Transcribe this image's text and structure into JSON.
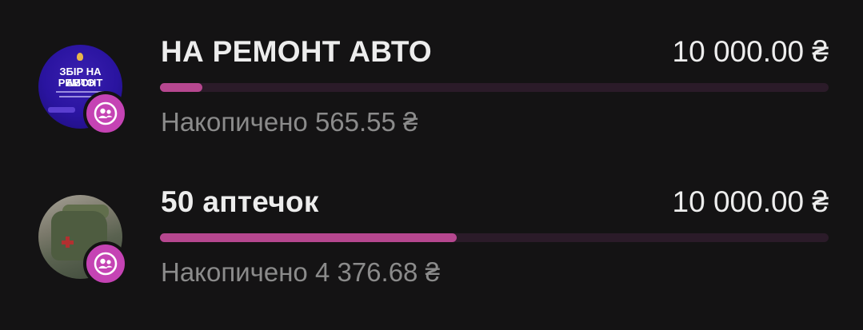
{
  "jars": [
    {
      "avatar_text_line1": "ЗБІР НА РЕМОНТ",
      "avatar_text_line2": "АВТО",
      "avatar_icon": "jar-cover-image",
      "badge_icon": "shared-jar-icon",
      "title": "НА РЕМОНТ АВТО",
      "goal": "10 000.00 ₴",
      "progress_fraction": 0.063,
      "saved_label": "Накопичено 565.55 ₴"
    },
    {
      "avatar_icon": "first-aid-kit-photo",
      "badge_icon": "shared-jar-icon",
      "title": "50 аптечок",
      "goal": "10 000.00 ₴",
      "progress_fraction": 0.444,
      "saved_label": "Накопичено 4 376.68 ₴"
    }
  ],
  "colors": {
    "background": "#141314",
    "progress_fill": "#b6478f",
    "progress_track": "#2b1b29",
    "badge": "#c543b4"
  }
}
